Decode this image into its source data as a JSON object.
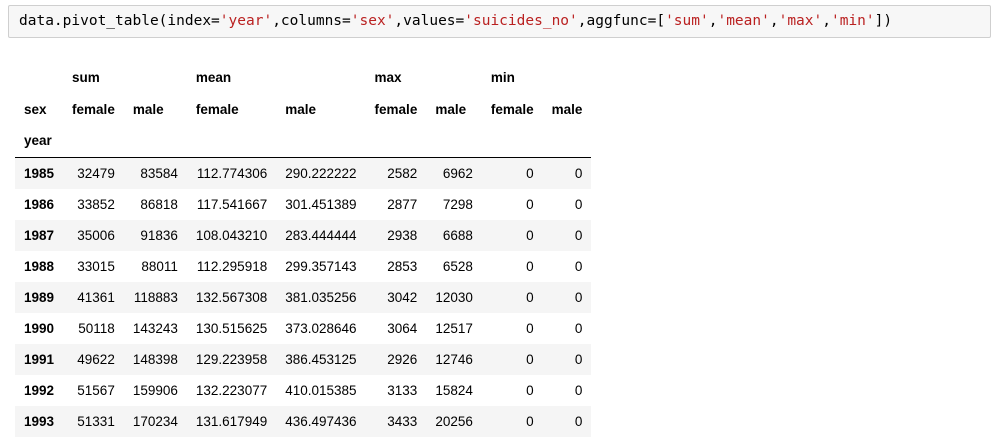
{
  "code": {
    "prefix": "data.pivot_table(index=",
    "index_val": "'year'",
    "sep1": ",columns=",
    "columns_val": "'sex'",
    "sep2": ",values=",
    "values_val": "'suicides_no'",
    "sep3": ",aggfunc=[",
    "agg1": "'sum'",
    "agg2": "'mean'",
    "agg3": "'max'",
    "agg4": "'min'",
    "suffix": "])",
    "comma": ","
  },
  "table": {
    "level0": [
      "sum",
      "mean",
      "max",
      "min"
    ],
    "columns_name": "sex",
    "level1": [
      "female",
      "male",
      "female",
      "male",
      "female",
      "male",
      "female",
      "male"
    ],
    "index_name": "year",
    "rows": [
      {
        "year": "1985",
        "values": [
          "32479",
          "83584",
          "112.774306",
          "290.222222",
          "2582",
          "6962",
          "0",
          "0"
        ]
      },
      {
        "year": "1986",
        "values": [
          "33852",
          "86818",
          "117.541667",
          "301.451389",
          "2877",
          "7298",
          "0",
          "0"
        ]
      },
      {
        "year": "1987",
        "values": [
          "35006",
          "91836",
          "108.043210",
          "283.444444",
          "2938",
          "6688",
          "0",
          "0"
        ]
      },
      {
        "year": "1988",
        "values": [
          "33015",
          "88011",
          "112.295918",
          "299.357143",
          "2853",
          "6528",
          "0",
          "0"
        ]
      },
      {
        "year": "1989",
        "values": [
          "41361",
          "118883",
          "132.567308",
          "381.035256",
          "3042",
          "12030",
          "0",
          "0"
        ]
      },
      {
        "year": "1990",
        "values": [
          "50118",
          "143243",
          "130.515625",
          "373.028646",
          "3064",
          "12517",
          "0",
          "0"
        ]
      },
      {
        "year": "1991",
        "values": [
          "49622",
          "148398",
          "129.223958",
          "386.453125",
          "2926",
          "12746",
          "0",
          "0"
        ]
      },
      {
        "year": "1992",
        "values": [
          "51567",
          "159906",
          "132.223077",
          "410.015385",
          "3133",
          "15824",
          "0",
          "0"
        ]
      },
      {
        "year": "1993",
        "values": [
          "51331",
          "170234",
          "131.617949",
          "436.497436",
          "3433",
          "20256",
          "0",
          "0"
        ]
      }
    ]
  },
  "colors": {
    "string": "#ba2121",
    "operator": "#aa22ff",
    "cell_bg": "#f7f7f7",
    "row_stripe": "#f5f5f5"
  }
}
